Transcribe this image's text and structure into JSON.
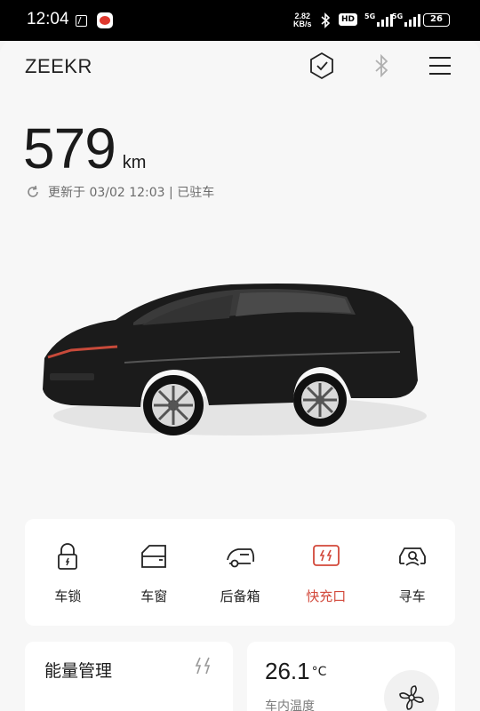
{
  "status_bar": {
    "time": "12:04",
    "net_speed_value": "2.82",
    "net_speed_unit": "KB/s",
    "hd_label": "HD",
    "sim1_label": "5G",
    "sim2_label": "5G",
    "battery_level": "26"
  },
  "header": {
    "brand": "ZEEKR",
    "icons": [
      "shield-check-icon",
      "bluetooth-icon",
      "menu-icon"
    ]
  },
  "range": {
    "value": "579",
    "unit": "km"
  },
  "update": {
    "text": "更新于 03/02 12:03 | 已驻车"
  },
  "controls": [
    {
      "label": "车锁",
      "icon": "lock-icon"
    },
    {
      "label": "车窗",
      "icon": "window-icon"
    },
    {
      "label": "后备箱",
      "icon": "trunk-icon"
    },
    {
      "label": "快充口",
      "icon": "charge-port-icon",
      "active": true
    },
    {
      "label": "寻车",
      "icon": "find-car-icon"
    }
  ],
  "energy": {
    "title": "能量管理"
  },
  "climate": {
    "temperature": "26.1",
    "unit": "°C",
    "label": "车内温度"
  },
  "colors": {
    "accent": "#d2483a",
    "background": "#f7f7f7",
    "card": "#ffffff",
    "statusbar": "#000000"
  }
}
